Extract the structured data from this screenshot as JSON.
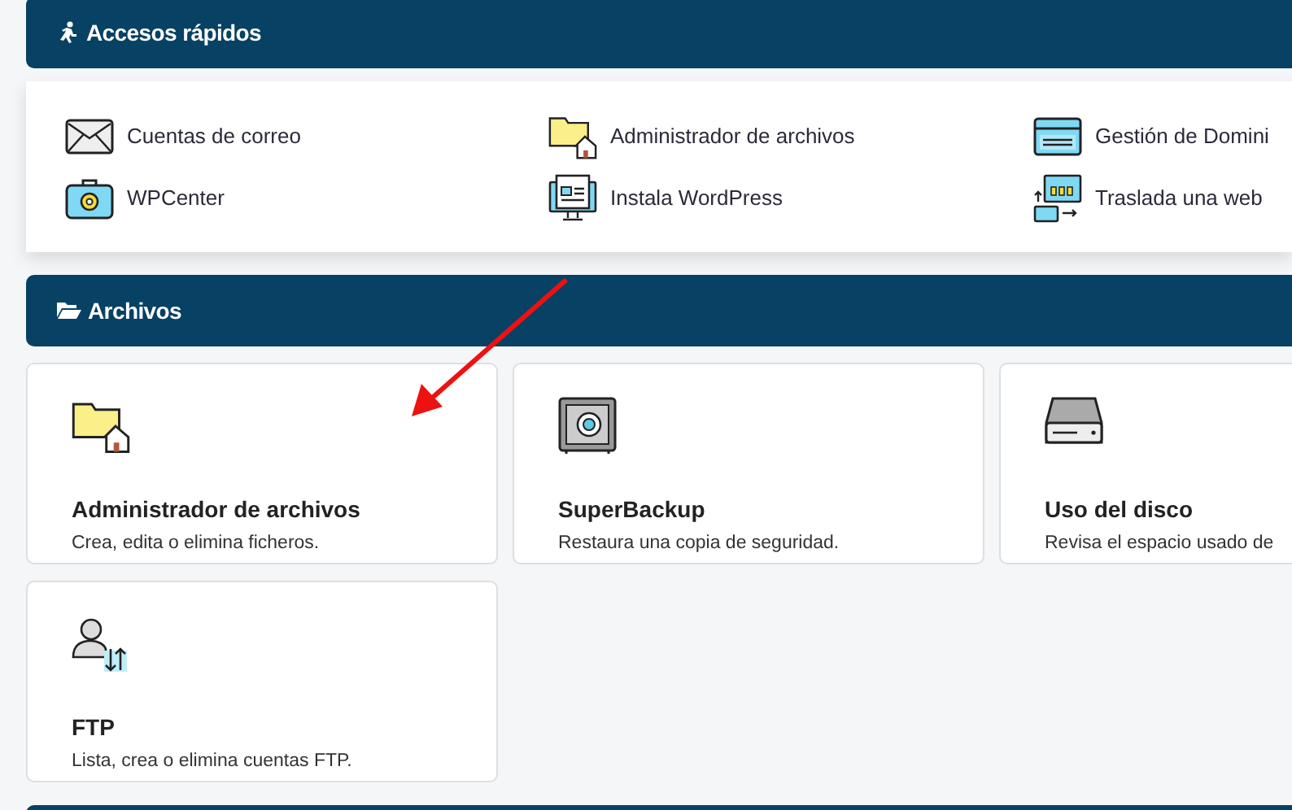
{
  "quick_access": {
    "title": "Accesos rápidos",
    "links": [
      {
        "label": "Cuentas de correo"
      },
      {
        "label": "Administrador de archivos"
      },
      {
        "label": "Gestión de Domini"
      },
      {
        "label": "WPCenter"
      },
      {
        "label": "Instala WordPress"
      },
      {
        "label": "Traslada una web"
      }
    ]
  },
  "files": {
    "title": "Archivos",
    "cards": [
      {
        "title": "Administrador de archivos",
        "description": "Crea, edita o elimina ficheros."
      },
      {
        "title": "SuperBackup",
        "description": "Restaura una copia de seguridad."
      },
      {
        "title": "Uso del disco",
        "description": "Revisa el espacio usado de"
      },
      {
        "title": "FTP",
        "description": "Lista, crea o elimina cuentas FTP."
      }
    ]
  }
}
